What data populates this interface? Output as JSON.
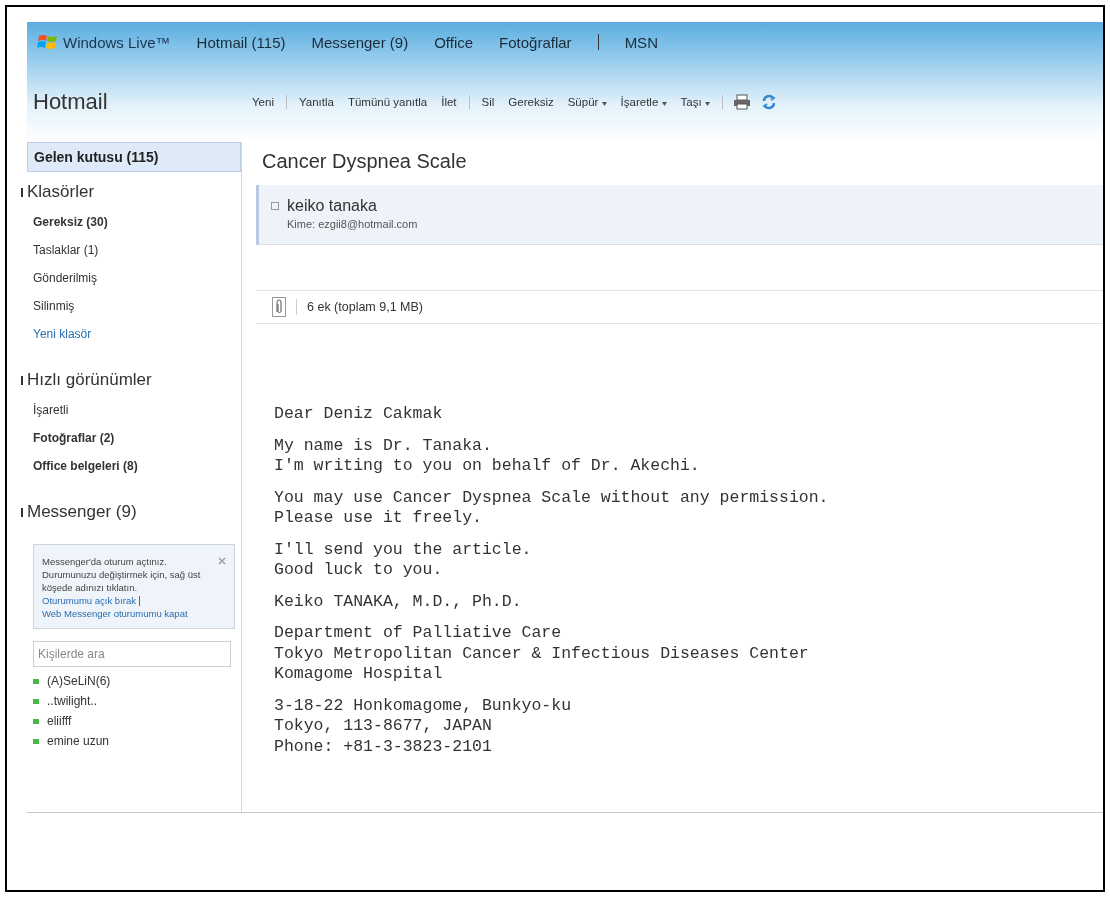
{
  "nav": {
    "brand": "Windows Live™",
    "groups": [
      [
        "Hotmail (115)",
        "Messenger (9)",
        "Office",
        "Fotoğraflar"
      ],
      [
        "MSN"
      ]
    ]
  },
  "sidebar": {
    "title": "Hotmail",
    "inbox": {
      "label": "Gelen kutusu (115)",
      "selected": true
    },
    "sections": [
      {
        "title": "Klasörler",
        "items": [
          {
            "kind": "folder",
            "label": "Gereksiz (30)",
            "unread": true
          },
          {
            "kind": "folder",
            "label": "Taslaklar (1)",
            "unread": false
          },
          {
            "kind": "folder",
            "label": "Gönderilmiş",
            "unread": false
          },
          {
            "kind": "folder",
            "label": "Silinmiş",
            "unread": false
          },
          {
            "kind": "link",
            "label": "Yeni klasör"
          }
        ]
      },
      {
        "title": "Hızlı görünümler",
        "items": [
          {
            "kind": "folder",
            "label": "İşaretli",
            "unread": false
          },
          {
            "kind": "folder",
            "label": "Fotoğraflar (2)",
            "unread": true
          },
          {
            "kind": "folder",
            "label": "Office belgeleri (8)",
            "unread": true
          }
        ]
      },
      {
        "title": "Messenger (9)"
      }
    ],
    "notice": {
      "text": "Messenger'da oturum açtınız. Durumunuzu değiştirmek için, sağ üst köşede adınızı tıklatın.",
      "links": [
        "Oturumumu açık bırak",
        "Web Messenger oturumumu kapat"
      ]
    },
    "search": {
      "placeholder": "Kişilerde ara"
    },
    "contacts": [
      {
        "name": "(A)SeLiN(6)",
        "color": "#46b846"
      },
      {
        "name": "..twilight..",
        "color": "#46b846"
      },
      {
        "name": "eliifff",
        "color": "#46b846"
      },
      {
        "name": "emine uzun",
        "color": "#46b846"
      }
    ]
  },
  "toolbar": {
    "groups": [
      [
        {
          "label": "Yeni",
          "menu": false
        }
      ],
      [
        {
          "label": "Yanıtla",
          "menu": false
        },
        {
          "label": "Tümünü yanıtla",
          "menu": false
        },
        {
          "label": "İlet",
          "menu": false
        }
      ],
      [
        {
          "label": "Sil",
          "menu": false
        },
        {
          "label": "Gereksiz",
          "menu": false
        },
        {
          "label": "Süpür",
          "menu": true
        },
        {
          "label": "İşaretle",
          "menu": true
        },
        {
          "label": "Taşı",
          "menu": true
        }
      ]
    ]
  },
  "message": {
    "subject": "Cancer Dyspnea Scale",
    "sender": "keiko tanaka",
    "to": "Kime: ezgii8@hotmail.com",
    "attachments": "6 ek (toplam 9,1 MB)",
    "body": [
      [
        "Dear Deniz Cakmak"
      ],
      [
        "My name is Dr. Tanaka.",
        "I'm writing to you on behalf of Dr. Akechi."
      ],
      [
        "You may use Cancer Dyspnea Scale without any permission.",
        "Please use it freely."
      ],
      [
        "I'll send you the article.",
        "Good luck to you."
      ],
      [
        "Keiko TANAKA, M.D., Ph.D."
      ],
      [
        "Department of Palliative Care",
        "Tokyo Metropolitan Cancer & Infectious Diseases Center",
        "Komagome Hospital"
      ],
      [
        "3-18-22 Honkomagome, Bunkyo-ku",
        "Tokyo, 113-8677, JAPAN",
        "Phone: +81-3-3823-2101"
      ]
    ]
  }
}
